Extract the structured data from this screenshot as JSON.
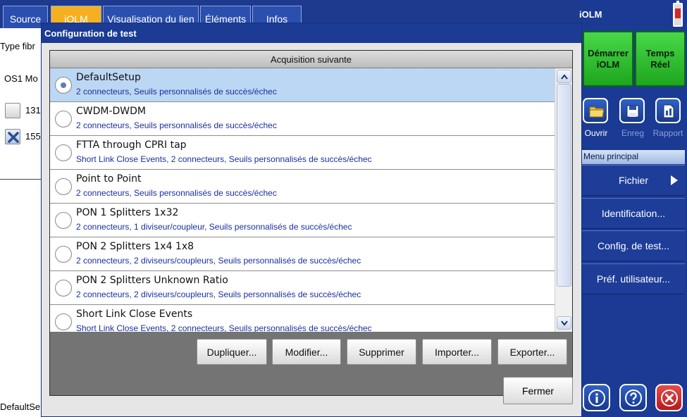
{
  "tabs": [
    "Source",
    "iOLM",
    "Visualisation du lien",
    "Éléments",
    "Infos"
  ],
  "background": {
    "fiber_type_label": "Type fibr",
    "fiber_value": "OS1 Mo",
    "wavelength_1": "131",
    "wavelength_2": "155",
    "setup_value": "DefaultSe"
  },
  "app": {
    "title": "iOLM"
  },
  "right_panel": {
    "start_button": "Démarrer iOLM",
    "realtime_button": "Temps Réel",
    "open_label": "Ouvrir",
    "save_label": "Enreg",
    "report_label": "Rapport",
    "menu_header": "Menu principal",
    "menu_items": [
      "Fichier",
      "Identification...",
      "Config. de test...",
      "Préf. utilisateur..."
    ]
  },
  "dialog": {
    "title": "Configuration de test",
    "list_header": "Acquisition suivante",
    "items": [
      {
        "name": "DefaultSetup",
        "desc": "2 connecteurs, Seuils personnalisés de succès/échec",
        "selected": true
      },
      {
        "name": "CWDM-DWDM",
        "desc": "2 connecteurs, Seuils personnalisés de succès/échec",
        "selected": false
      },
      {
        "name": "FTTA through CPRI tap",
        "desc": "Short Link Close Events, 2 connecteurs, Seuils personnalisés de succès/échec",
        "selected": false
      },
      {
        "name": "Point to Point",
        "desc": "2 connecteurs, Seuils personnalisés de succès/échec",
        "selected": false
      },
      {
        "name": "PON 1 Splitters 1x32",
        "desc": "2 connecteurs, 1 diviseur/coupleur, Seuils personnalisés de succès/échec",
        "selected": false
      },
      {
        "name": "PON 2 Splitters 1x4 1x8",
        "desc": "2 connecteurs, 2 diviseurs/coupleurs, Seuils personnalisés de succès/échec",
        "selected": false
      },
      {
        "name": "PON 2 Splitters Unknown Ratio",
        "desc": "2 connecteurs, 2 diviseurs/coupleurs, Seuils personnalisés de succès/échec",
        "selected": false
      },
      {
        "name": "Short Link Close Events",
        "desc": "Short Link Close Events, 2 connecteurs, Seuils personnalisés de succès/échec",
        "selected": false
      }
    ],
    "buttons": {
      "duplicate": "Dupliquer...",
      "modify": "Modifier...",
      "delete": "Supprimer",
      "import": "Importer...",
      "export": "Exporter...",
      "close": "Fermer"
    }
  },
  "colors": {
    "brand_blue": "#1b3b94",
    "active_tab": "#f5b021",
    "start_green": "#2cc22c",
    "selection": "#bcd7f3",
    "exit_red": "#d62b2b"
  }
}
